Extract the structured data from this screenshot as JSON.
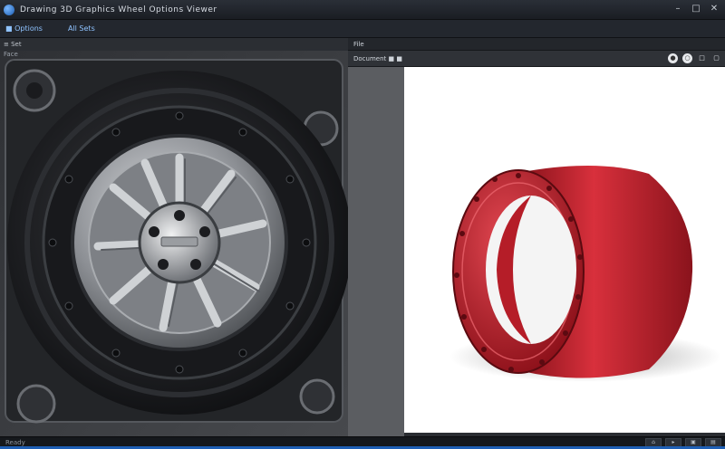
{
  "window": {
    "title": "Drawing 3D Graphics Wheel Options Viewer",
    "controls": [
      "–",
      "□",
      "✕"
    ]
  },
  "toolbar": {
    "item1": "■ Options",
    "item2": "All Sets"
  },
  "left_viewport": {
    "header": "≡ Set",
    "sub": "Face"
  },
  "right_panel": {
    "tab": "File",
    "doc_label": "Document ■ ■",
    "view_tools": [
      "●",
      "○",
      "□",
      "▢"
    ]
  },
  "statusbar": {
    "text": "Ready",
    "right_items": [
      "⌂",
      "▸",
      "▣",
      "▤"
    ]
  },
  "colors": {
    "accent": "#1e5fb5",
    "ring_red": "#c8202e",
    "wheel_gray": "#6b6e73"
  }
}
